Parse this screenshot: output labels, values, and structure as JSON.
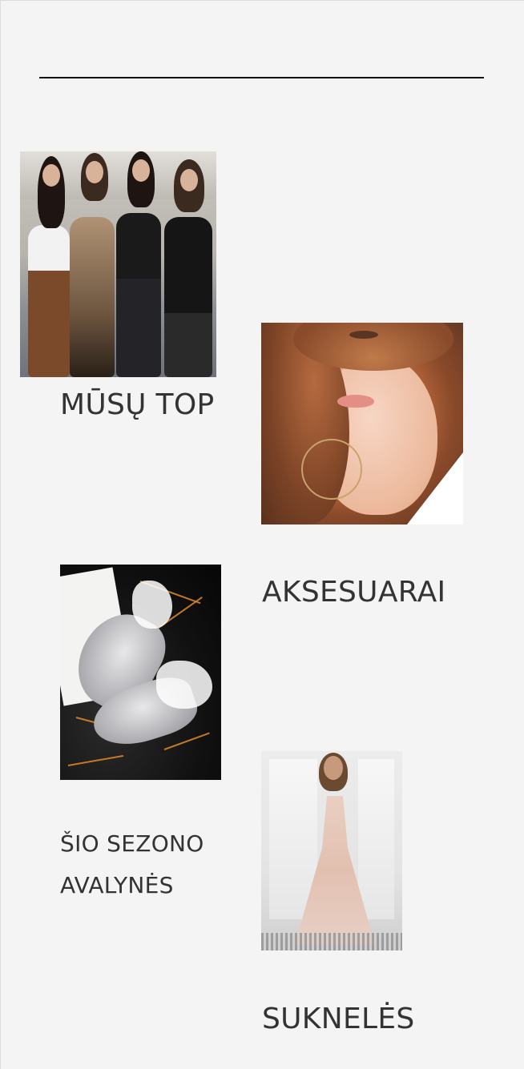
{
  "sections": [
    {
      "label": "MŪSŲ TOP"
    },
    {
      "label": "AKSESUARAI"
    },
    {
      "label": "ŠIO SEZONO AVALYNĖS",
      "lines": [
        "ŠIO SEZONO",
        "AVALYNĖS"
      ]
    },
    {
      "label": "SUKNELĖS"
    }
  ],
  "images": {
    "top": "street-style-group-photo",
    "accessories": "woman-face-hoop-earring-photo",
    "shoes": "glitter-high-heels-photo",
    "dresses": "evening-gown-photo"
  },
  "colors": {
    "background": "#f4f4f4",
    "text": "#333333",
    "rule": "#111111"
  }
}
